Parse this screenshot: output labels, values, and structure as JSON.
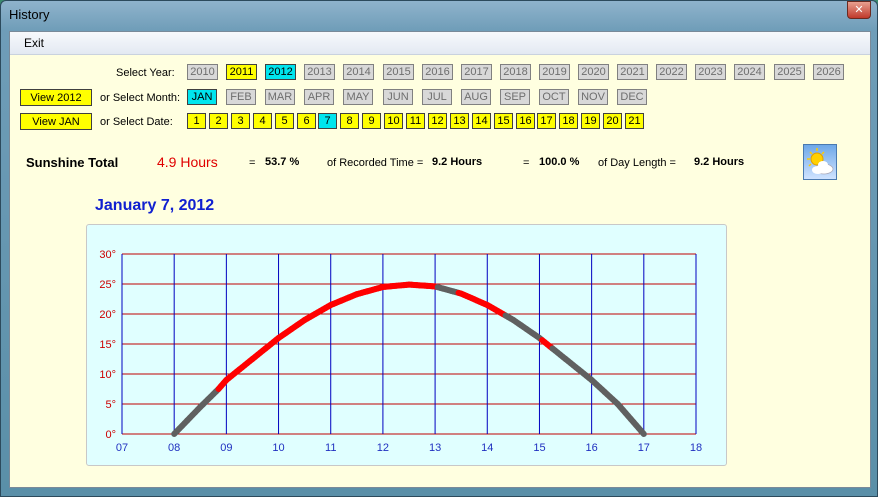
{
  "window": {
    "title": "History"
  },
  "menu": {
    "exit": "Exit"
  },
  "labels": {
    "select_year": "Select Year:",
    "select_month": "or Select Month:",
    "select_date": "or Select Date:"
  },
  "view_buttons": {
    "year": "View 2012",
    "month": "View JAN"
  },
  "years": [
    "2010",
    "2011",
    "2012",
    "2013",
    "2014",
    "2015",
    "2016",
    "2017",
    "2018",
    "2019",
    "2020",
    "2021",
    "2022",
    "2023",
    "2024",
    "2025",
    "2026"
  ],
  "months": [
    "JAN",
    "FEB",
    "MAR",
    "APR",
    "MAY",
    "JUN",
    "JUL",
    "AUG",
    "SEP",
    "OCT",
    "NOV",
    "DEC"
  ],
  "dates": [
    "1",
    "2",
    "3",
    "4",
    "5",
    "6",
    "7",
    "8",
    "9",
    "10",
    "11",
    "12",
    "13",
    "14",
    "15",
    "16",
    "17",
    "18",
    "19",
    "20",
    "21"
  ],
  "states": {
    "year_available": [
      "2011"
    ],
    "year_selected": "2012",
    "month_selected": "JAN",
    "date_selected": "7"
  },
  "sunshine": {
    "label": "Sunshine Total",
    "hours": "4.9 Hours",
    "eq1": "=",
    "pct_recorded": "53.7 %",
    "of_recorded": "of Recorded Time =",
    "recorded_time": "9.2 Hours",
    "eq2": "=",
    "pct_day": "100.0 %",
    "of_day": "of Day Length =",
    "day_length": "9.2 Hours"
  },
  "icons": {
    "weather": "sun-behind-cloud-icon"
  },
  "date_title": "January 7, 2012",
  "colors": {
    "sun": "#ff0000",
    "cloud": "#606060",
    "hgrid": "#c00000",
    "vgrid": "#0000c0",
    "ylabel": "#cc0000",
    "xlabel": "#2030c0"
  },
  "chart_data": {
    "type": "line",
    "title": "",
    "xlabel": "",
    "ylabel": "",
    "x_ticks": [
      "07",
      "08",
      "09",
      "10",
      "11",
      "12",
      "13",
      "14",
      "15",
      "16",
      "17",
      "18"
    ],
    "y_ticks": [
      "0°",
      "5°",
      "10°",
      "15°",
      "20°",
      "25°",
      "30°"
    ],
    "xlim": [
      7,
      18
    ],
    "ylim": [
      0,
      30
    ],
    "grid": true,
    "series": [
      {
        "points": [
          {
            "x": 8.0,
            "y": 0
          },
          {
            "x": 8.5,
            "y": 4.5
          },
          {
            "x": 8.85,
            "y": 7.5
          },
          {
            "x": 9.0,
            "y": 9
          },
          {
            "x": 9.5,
            "y": 12.5
          },
          {
            "x": 10.0,
            "y": 16
          },
          {
            "x": 10.5,
            "y": 19
          },
          {
            "x": 11.0,
            "y": 21.5
          },
          {
            "x": 11.5,
            "y": 23.3
          },
          {
            "x": 12.0,
            "y": 24.5
          },
          {
            "x": 12.5,
            "y": 24.9
          },
          {
            "x": 13.0,
            "y": 24.6
          },
          {
            "x": 13.5,
            "y": 23.4
          },
          {
            "x": 14.0,
            "y": 21.5
          },
          {
            "x": 14.5,
            "y": 19
          },
          {
            "x": 15.0,
            "y": 16
          },
          {
            "x": 15.5,
            "y": 12.5
          },
          {
            "x": 16.0,
            "y": 9
          },
          {
            "x": 16.5,
            "y": 5
          },
          {
            "x": 17.0,
            "y": 0
          }
        ],
        "sunshine_intervals": [
          [
            8.85,
            13.05
          ],
          [
            13.45,
            14.35
          ],
          [
            15.05,
            15.25
          ]
        ]
      }
    ]
  }
}
